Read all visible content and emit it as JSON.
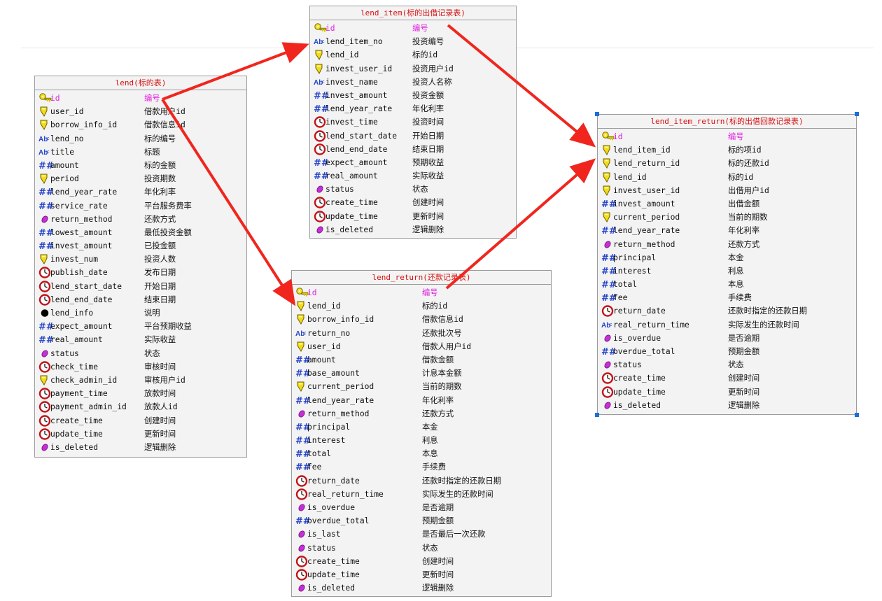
{
  "tables": [
    {
      "key": "lend",
      "title": "lend(标的表)",
      "fields": [
        {
          "name": "id",
          "comment": "编号",
          "icon": "key-icon",
          "pk": true
        },
        {
          "name": "user_id",
          "comment": "借款用户id",
          "icon": "fk-icon"
        },
        {
          "name": "borrow_info_id",
          "comment": "借款信息id",
          "icon": "fk-icon"
        },
        {
          "name": "lend_no",
          "comment": "标的编号",
          "icon": "text-icon"
        },
        {
          "name": "title",
          "comment": "标题",
          "icon": "text-icon"
        },
        {
          "name": "amount",
          "comment": "标的金额",
          "icon": "decimal-icon"
        },
        {
          "name": "period",
          "comment": "投资期数",
          "icon": "fk-icon"
        },
        {
          "name": "lend_year_rate",
          "comment": "年化利率",
          "icon": "decimal-icon"
        },
        {
          "name": "service_rate",
          "comment": "平台服务费率",
          "icon": "decimal-icon"
        },
        {
          "name": "return_method",
          "comment": "还款方式",
          "icon": "tinyint-icon"
        },
        {
          "name": "lowest_amount",
          "comment": "最低投资金额",
          "icon": "decimal-icon"
        },
        {
          "name": "invest_amount",
          "comment": "已投金额",
          "icon": "decimal-icon"
        },
        {
          "name": "invest_num",
          "comment": "投资人数",
          "icon": "fk-icon"
        },
        {
          "name": "publish_date",
          "comment": "发布日期",
          "icon": "datetime-icon"
        },
        {
          "name": "lend_start_date",
          "comment": "开始日期",
          "icon": "datetime-icon"
        },
        {
          "name": "lend_end_date",
          "comment": "结束日期",
          "icon": "datetime-icon"
        },
        {
          "name": "lend_info",
          "comment": "说明",
          "icon": "blob-icon"
        },
        {
          "name": "expect_amount",
          "comment": "平台预期收益",
          "icon": "decimal-icon"
        },
        {
          "name": "real_amount",
          "comment": "实际收益",
          "icon": "decimal-icon"
        },
        {
          "name": "status",
          "comment": "状态",
          "icon": "tinyint-icon"
        },
        {
          "name": "check_time",
          "comment": "审核时间",
          "icon": "datetime-icon"
        },
        {
          "name": "check_admin_id",
          "comment": "审核用户id",
          "icon": "fk-icon"
        },
        {
          "name": "payment_time",
          "comment": "放款时间",
          "icon": "datetime-icon"
        },
        {
          "name": "payment_admin_id",
          "comment": "放款人id",
          "icon": "datetime-icon"
        },
        {
          "name": "create_time",
          "comment": "创建时间",
          "icon": "datetime-icon"
        },
        {
          "name": "update_time",
          "comment": "更新时间",
          "icon": "datetime-icon"
        },
        {
          "name": "is_deleted",
          "comment": "逻辑删除",
          "icon": "tinyint-icon"
        }
      ]
    },
    {
      "key": "lend_item",
      "title": "lend_item(标的出借记录表)",
      "fields": [
        {
          "name": "id",
          "comment": "编号",
          "icon": "key-icon",
          "pk": true
        },
        {
          "name": "lend_item_no",
          "comment": "投资编号",
          "icon": "text-icon"
        },
        {
          "name": "lend_id",
          "comment": "标的id",
          "icon": "fk-icon"
        },
        {
          "name": "invest_user_id",
          "comment": "投资用户id",
          "icon": "fk-icon"
        },
        {
          "name": "invest_name",
          "comment": "投资人名称",
          "icon": "text-icon"
        },
        {
          "name": "invest_amount",
          "comment": "投资金额",
          "icon": "decimal-icon"
        },
        {
          "name": "lend_year_rate",
          "comment": "年化利率",
          "icon": "decimal-icon"
        },
        {
          "name": "invest_time",
          "comment": "投资时间",
          "icon": "datetime-icon"
        },
        {
          "name": "lend_start_date",
          "comment": "开始日期",
          "icon": "datetime-icon"
        },
        {
          "name": "lend_end_date",
          "comment": "结束日期",
          "icon": "datetime-icon"
        },
        {
          "name": "expect_amount",
          "comment": "预期收益",
          "icon": "decimal-icon"
        },
        {
          "name": "real_amount",
          "comment": "实际收益",
          "icon": "decimal-icon"
        },
        {
          "name": "status",
          "comment": "状态",
          "icon": "tinyint-icon"
        },
        {
          "name": "create_time",
          "comment": "创建时间",
          "icon": "datetime-icon"
        },
        {
          "name": "update_time",
          "comment": "更新时间",
          "icon": "datetime-icon"
        },
        {
          "name": "is_deleted",
          "comment": "逻辑删除",
          "icon": "tinyint-icon"
        }
      ]
    },
    {
      "key": "lend_return",
      "title": "lend_return(还款记录表)",
      "fields": [
        {
          "name": "id",
          "comment": "编号",
          "icon": "key-icon",
          "pk": true
        },
        {
          "name": "lend_id",
          "comment": "标的id",
          "icon": "fk-icon"
        },
        {
          "name": "borrow_info_id",
          "comment": "借款信息id",
          "icon": "fk-icon"
        },
        {
          "name": "return_no",
          "comment": "还款批次号",
          "icon": "text-icon"
        },
        {
          "name": "user_id",
          "comment": "借款人用户id",
          "icon": "fk-icon"
        },
        {
          "name": "amount",
          "comment": "借款金额",
          "icon": "decimal-icon"
        },
        {
          "name": "base_amount",
          "comment": "计息本金额",
          "icon": "decimal-icon"
        },
        {
          "name": "current_period",
          "comment": "当前的期数",
          "icon": "fk-icon"
        },
        {
          "name": "lend_year_rate",
          "comment": "年化利率",
          "icon": "decimal-icon"
        },
        {
          "name": "return_method",
          "comment": "还款方式",
          "icon": "tinyint-icon"
        },
        {
          "name": "principal",
          "comment": "本金",
          "icon": "decimal-icon"
        },
        {
          "name": "interest",
          "comment": "利息",
          "icon": "decimal-icon"
        },
        {
          "name": "total",
          "comment": "本息",
          "icon": "decimal-icon"
        },
        {
          "name": "fee",
          "comment": "手续费",
          "icon": "decimal-icon"
        },
        {
          "name": "return_date",
          "comment": "还款时指定的还款日期",
          "icon": "datetime-icon"
        },
        {
          "name": "real_return_time",
          "comment": "实际发生的还款时间",
          "icon": "datetime-icon"
        },
        {
          "name": "is_overdue",
          "comment": "是否逾期",
          "icon": "tinyint-icon"
        },
        {
          "name": "overdue_total",
          "comment": "预期金额",
          "icon": "decimal-icon"
        },
        {
          "name": "is_last",
          "comment": "是否最后一次还款",
          "icon": "tinyint-icon"
        },
        {
          "name": "status",
          "comment": "状态",
          "icon": "tinyint-icon"
        },
        {
          "name": "create_time",
          "comment": "创建时间",
          "icon": "datetime-icon"
        },
        {
          "name": "update_time",
          "comment": "更新时间",
          "icon": "datetime-icon"
        },
        {
          "name": "is_deleted",
          "comment": "逻辑删除",
          "icon": "tinyint-icon"
        }
      ]
    },
    {
      "key": "lend_item_return",
      "title": "lend_item_return(标的出借回款记录表)",
      "fields": [
        {
          "name": "id",
          "comment": "编号",
          "icon": "key-icon",
          "pk": true
        },
        {
          "name": "lend_item_id",
          "comment": "标的项id",
          "icon": "fk-icon"
        },
        {
          "name": "lend_return_id",
          "comment": "标的还款id",
          "icon": "fk-icon"
        },
        {
          "name": "lend_id",
          "comment": "标的id",
          "icon": "fk-icon"
        },
        {
          "name": "invest_user_id",
          "comment": "出借用户id",
          "icon": "fk-icon"
        },
        {
          "name": "invest_amount",
          "comment": "出借金额",
          "icon": "decimal-icon"
        },
        {
          "name": "current_period",
          "comment": "当前的期数",
          "icon": "fk-icon"
        },
        {
          "name": "lend_year_rate",
          "comment": "年化利率",
          "icon": "decimal-icon"
        },
        {
          "name": "return_method",
          "comment": "还款方式",
          "icon": "tinyint-icon"
        },
        {
          "name": "principal",
          "comment": "本金",
          "icon": "decimal-icon"
        },
        {
          "name": "interest",
          "comment": "利息",
          "icon": "decimal-icon"
        },
        {
          "name": "total",
          "comment": "本息",
          "icon": "decimal-icon"
        },
        {
          "name": "fee",
          "comment": "手续费",
          "icon": "decimal-icon"
        },
        {
          "name": "return_date",
          "comment": "还款时指定的还款日期",
          "icon": "datetime-icon"
        },
        {
          "name": "real_return_time",
          "comment": "实际发生的还款时间",
          "icon": "text-icon"
        },
        {
          "name": "is_overdue",
          "comment": "是否逾期",
          "icon": "tinyint-icon"
        },
        {
          "name": "overdue_total",
          "comment": "预期金额",
          "icon": "decimal-icon"
        },
        {
          "name": "status",
          "comment": "状态",
          "icon": "tinyint-icon"
        },
        {
          "name": "create_time",
          "comment": "创建时间",
          "icon": "datetime-icon"
        },
        {
          "name": "update_time",
          "comment": "更新时间",
          "icon": "datetime-icon"
        },
        {
          "name": "is_deleted",
          "comment": "逻辑删除",
          "icon": "tinyint-icon"
        }
      ]
    }
  ],
  "colors": {
    "arrow": "#f0261e",
    "title_text": "#d81010",
    "pk_text": "#e022e0",
    "selection_handle": "#1b6fd8"
  }
}
